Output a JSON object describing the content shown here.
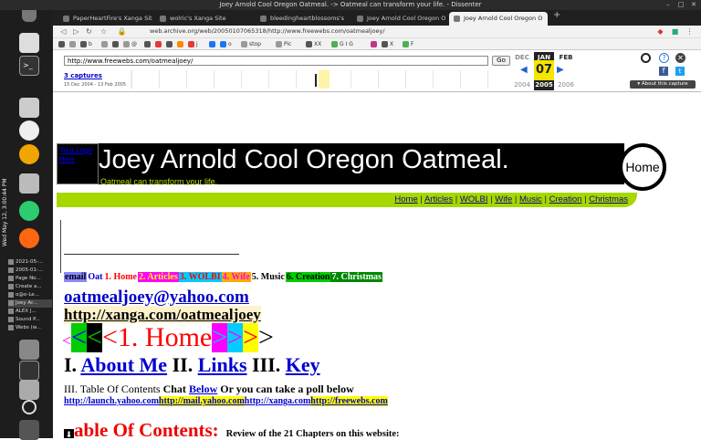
{
  "window": {
    "title": "Joey Arnold Cool Oregon Oatmeal. -> Oatmeal can transform your life. - Dissenter"
  },
  "dock": {
    "clock": "Wed May 12,  3:00:44 PM",
    "taskbar_items": [
      "2021-05-...",
      "2005-01-...",
      "Page No...",
      "Create a...",
      "o@o-Le...",
      "Joey Ar...",
      "ALEX J...",
      "Sound P...",
      "Webs (w..."
    ]
  },
  "tabs": [
    {
      "label": "PaperHeartFire's Xanga Sit"
    },
    {
      "label": "wolric's Xanga Site"
    },
    {
      "label": "bleedingheartblossoms's"
    },
    {
      "label": "Joey Arnold Cool Oregon O"
    },
    {
      "label": "Joey Arnold Cool Oregon O"
    }
  ],
  "navbar": {
    "url": "web.archive.org/web/20050107065318/http://www.freewebs.com/oatmealjoey/"
  },
  "bookmarks": [
    {
      "label": "",
      "color": "#555555"
    },
    {
      "label": "",
      "color": "#999999"
    },
    {
      "label": "b",
      "color": "#555555"
    },
    {
      "label": "",
      "color": "#999999"
    },
    {
      "label": "",
      "color": "#555555"
    },
    {
      "label": "@",
      "color": "#999999"
    },
    {
      "label": "",
      "color": "#555555"
    },
    {
      "label": "",
      "color": "#e53935"
    },
    {
      "label": "",
      "color": "#555555"
    },
    {
      "label": "",
      "color": "#ff8800"
    },
    {
      "label": "j",
      "color": "#e53935"
    },
    {
      "label": "",
      "color": "#1877f2"
    },
    {
      "label": "o",
      "color": "#1877f2"
    },
    {
      "label": "stop",
      "color": "#999999"
    },
    {
      "label": "Pic",
      "color": "#999999"
    },
    {
      "label": "XX",
      "color": "#555555"
    },
    {
      "label": "G I G",
      "color": "#4caf50"
    },
    {
      "label": "",
      "color": "#c13584"
    },
    {
      "label": "X",
      "color": "#555555"
    },
    {
      "label": "F",
      "color": "#4caf50"
    }
  ],
  "wayback": {
    "url_value": "http://www.freewebs.com/oatmealjoey/",
    "go_label": "Go",
    "captures_label": "3 captures",
    "date_range": "15 Dec 2004 - 13 Feb 2005",
    "prev_month": "DEC",
    "cur_month": "JAN",
    "next_month": "FEB",
    "day": "07",
    "prev_year": "2004",
    "cur_year": "2005",
    "next_year": "2006",
    "about_label": "About this capture"
  },
  "site": {
    "logo_alt": "Your Logo Here",
    "title": "Joey Arnold Cool Oregon Oatmeal.",
    "tagline": "Oatmeal can transform your life.",
    "home_button": "Home",
    "nav": [
      "Home",
      "Articles",
      "WOLBI",
      "Wife",
      "Music",
      "Creation",
      "Christmas"
    ],
    "chapters": [
      {
        "text": "email",
        "bg": "#8888ff",
        "fg": "#000000"
      },
      {
        "text": "Oat",
        "bg": "#ffffff",
        "fg": "#0000cc"
      },
      {
        "text": "1. Home",
        "bg": "#ffffff",
        "fg": "#ff0000"
      },
      {
        "text": "2. Articles",
        "bg": "#ff00ff",
        "fg": "#ffff00"
      },
      {
        "text": "3. WOLBI",
        "bg": "#00ccff",
        "fg": "#ff0000"
      },
      {
        "text": "4. Wife",
        "bg": "#ffaa00",
        "fg": "#ff00ff"
      },
      {
        "text": "5. Music",
        "bg": "#ffffff",
        "fg": "#000000"
      },
      {
        "text": "6. Creation",
        "bg": "#00cc00",
        "fg": "#000000"
      },
      {
        "text": "7. Christmas",
        "bg": "#008800",
        "fg": "#ffffff"
      }
    ],
    "email": "oatmealjoey@yahoo.com",
    "xanga": "http://xanga.com/oatmealjoey",
    "home_arrows": [
      {
        "text": "<",
        "bg": "#ffffff",
        "fg": "#ff00ff",
        "size": "small"
      },
      {
        "text": "<",
        "bg": "#00cc00",
        "fg": "#0000ff",
        "size": "big"
      },
      {
        "text": "<",
        "bg": "#000000",
        "fg": "#00cc00",
        "size": "big"
      },
      {
        "text": "<",
        "bg": "#ffffff",
        "fg": "#ff0000",
        "size": "big"
      },
      {
        "text": "1. Home",
        "bg": "#ffffff",
        "fg": "#ff0000",
        "size": "big"
      },
      {
        "text": ">",
        "bg": "#ff00ff",
        "fg": "#00ccff",
        "size": "big"
      },
      {
        "text": ">",
        "bg": "#00ccff",
        "fg": "#ff00ff",
        "size": "big"
      },
      {
        "text": ">",
        "bg": "#ffff00",
        "fg": "#ff0000",
        "size": "big"
      },
      {
        "text": ">",
        "bg": "#ffffff",
        "fg": "#000000",
        "size": "big"
      }
    ],
    "about_row": {
      "n1": "I.",
      "l1": "About Me",
      "n2": "II.",
      "l2": "Links",
      "n3": "III.",
      "l3": "Key"
    },
    "toc_line": {
      "prefix": "III. Table Of Contents",
      "chat": "Chat",
      "below": "Below",
      "suffix": "Or you can take a poll below"
    },
    "links_line": [
      "http://launch.yahoo.com",
      "http://mail.yahoo.com",
      "http://xanga.com",
      "http://freewebs.com"
    ],
    "toc_heading": "able Of Contents:",
    "toc_review": "Review of the 21 Chapters on this website:"
  }
}
